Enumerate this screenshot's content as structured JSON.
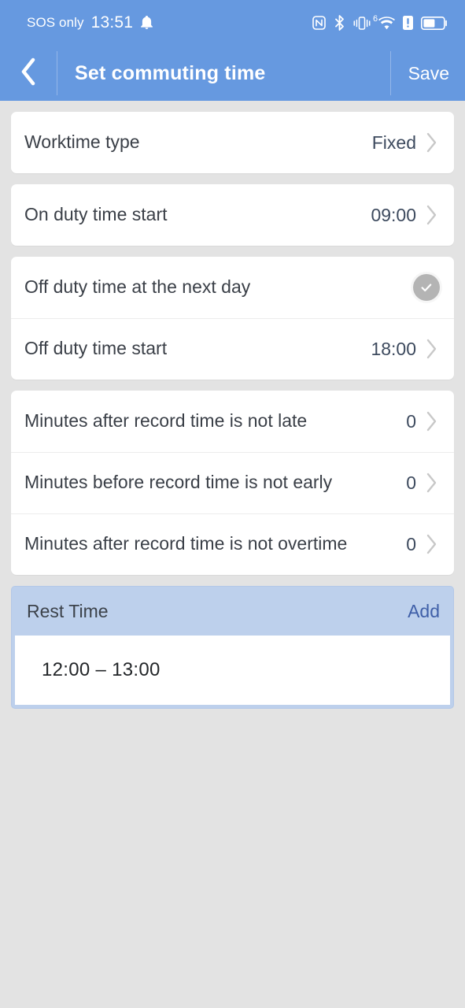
{
  "status_bar": {
    "carrier": "SOS only",
    "clock": "13:51",
    "icons": [
      "bell-icon",
      "nfc-icon",
      "bluetooth-icon",
      "vibrate-icon",
      "wifi-icon",
      "alert-icon",
      "battery-icon"
    ],
    "wifi_generation": "6"
  },
  "app_bar": {
    "back_icon": "chevron-left-icon",
    "title": "Set commuting time",
    "save_label": "Save"
  },
  "colors": {
    "header_blue": "#6699e0",
    "page_background": "#e3e3e3",
    "card_white": "#ffffff",
    "value_text": "#3d4a5e",
    "label_text": "#3a3f47",
    "rest_header_blue": "#bdd0ec",
    "link_blue": "#3f5fa8",
    "check_gray": "#b4b4b4",
    "chevron_gray": "#c8c8c8"
  },
  "sections": [
    {
      "name": "worktime-type-section",
      "rows": [
        {
          "label": "Worktime type",
          "value": "Fixed",
          "accessory": "chevron-right-icon"
        }
      ]
    },
    {
      "name": "on-duty-section",
      "rows": [
        {
          "label": "On duty time start",
          "value": "09:00",
          "accessory": "chevron-right-icon"
        }
      ]
    },
    {
      "name": "off-duty-section",
      "rows": [
        {
          "label": "Off duty time at the next day",
          "value": "",
          "accessory": "check-circle-icon",
          "checked": true
        },
        {
          "label": "Off duty time start",
          "value": "18:00",
          "accessory": "chevron-right-icon"
        }
      ]
    },
    {
      "name": "minutes-section",
      "rows": [
        {
          "label": "Minutes after record time is not late",
          "value": "0",
          "accessory": "chevron-right-icon"
        },
        {
          "label": "Minutes before record time is not early",
          "value": "0",
          "accessory": "chevron-right-icon"
        },
        {
          "label": "Minutes after record time is not overtime",
          "value": "0",
          "accessory": "chevron-right-icon"
        }
      ]
    }
  ],
  "rest_time": {
    "title": "Rest Time",
    "add_label": "Add",
    "entries": [
      {
        "range": "12:00 – 13:00"
      }
    ]
  }
}
